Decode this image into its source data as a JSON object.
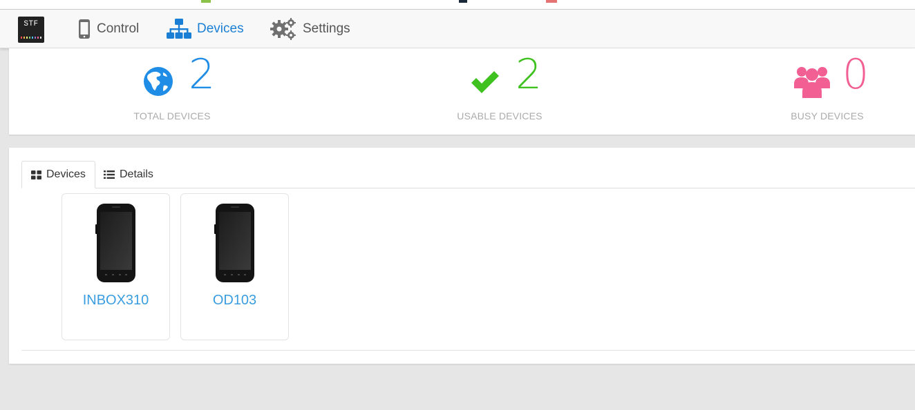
{
  "nav": {
    "logo_text": "STF",
    "items": [
      {
        "label": "Control",
        "icon": "mobile-icon"
      },
      {
        "label": "Devices",
        "icon": "sitemap-icon",
        "active": true
      },
      {
        "label": "Settings",
        "icon": "gears-icon"
      }
    ]
  },
  "stats": [
    {
      "value": "2",
      "label": "TOTAL DEVICES",
      "icon": "globe-icon",
      "color": "#1f8ce6"
    },
    {
      "value": "2",
      "label": "USABLE DEVICES",
      "icon": "check-icon",
      "color": "#3fc11f"
    },
    {
      "value": "0",
      "label": "BUSY DEVICES",
      "icon": "users-icon",
      "color": "#f25f93"
    }
  ],
  "tabs": [
    {
      "label": "Devices",
      "icon": "th-large-icon",
      "active": true
    },
    {
      "label": "Details",
      "icon": "list-icon"
    }
  ],
  "devices": [
    {
      "name": "INBOX310",
      "icon": "phone-image"
    },
    {
      "name": "OD103",
      "icon": "phone-image"
    }
  ],
  "colors": {
    "accent": "#1a7fd4",
    "device_name": "#3a9ddf",
    "label_gray": "#aaaaaa",
    "background": "#e6e6e6"
  }
}
